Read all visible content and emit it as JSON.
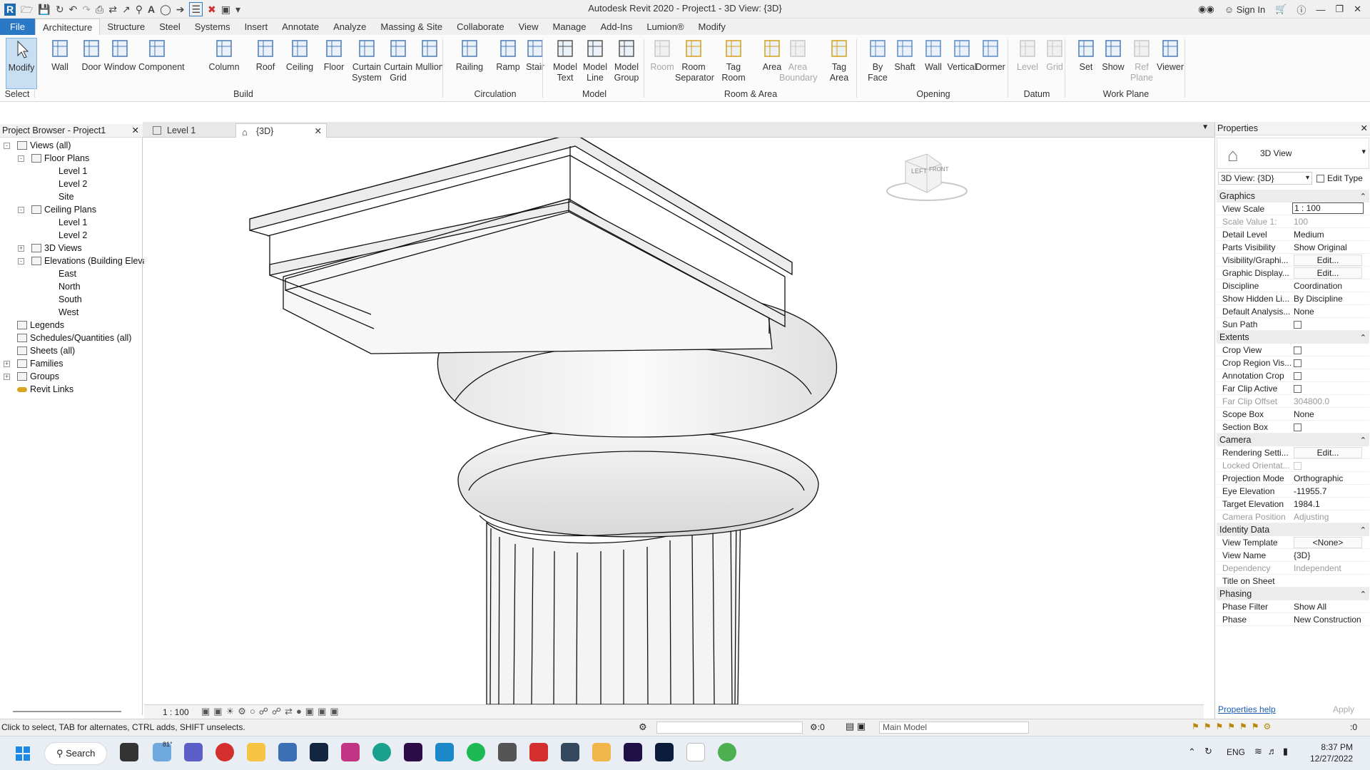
{
  "app": {
    "title": "Autodesk Revit 2020 - Project1 - 3D View: {3D}",
    "sign_in": "Sign In"
  },
  "ribbon_tabs": [
    "File",
    "Architecture",
    "Structure",
    "Steel",
    "Systems",
    "Insert",
    "Annotate",
    "Analyze",
    "Massing & Site",
    "Collaborate",
    "View",
    "Manage",
    "Add-Ins",
    "Lumion®",
    "Modify"
  ],
  "ribbon": {
    "select": {
      "modify": "Modify",
      "panel": "Select"
    },
    "build": {
      "items": [
        "Wall",
        "Door",
        "Window",
        "Component",
        "Column",
        "Roof",
        "Ceiling",
        "Floor",
        "Curtain\nSystem",
        "Curtain\nGrid",
        "Mullion"
      ],
      "panel": "Build"
    },
    "circulation": {
      "items": [
        "Railing",
        "Ramp",
        "Stair"
      ],
      "panel": "Circulation"
    },
    "model": {
      "items": [
        "Model\nText",
        "Model\nLine",
        "Model\nGroup"
      ],
      "panel": "Model"
    },
    "room_area": {
      "items": [
        "Room",
        "Room\nSeparator",
        "Tag\nRoom",
        "Area",
        "Area\nBoundary",
        "Tag\nArea"
      ],
      "panel": "Room & Area"
    },
    "opening": {
      "items": [
        "By\nFace",
        "Shaft",
        "Wall",
        "Vertical",
        "Dormer"
      ],
      "panel": "Opening"
    },
    "datum": {
      "items": [
        "Level",
        "Grid"
      ],
      "panel": "Datum"
    },
    "work_plane": {
      "items": [
        "Set",
        "Show",
        "Ref\nPlane",
        "Viewer"
      ],
      "panel": "Work Plane"
    }
  },
  "browser": {
    "title": "Project Browser - Project1",
    "items": [
      {
        "label": "Views (all)",
        "level": 0,
        "box": "-"
      },
      {
        "label": "Floor Plans",
        "level": 1,
        "box": "-"
      },
      {
        "label": "Level 1",
        "level": 2
      },
      {
        "label": "Level 2",
        "level": 2
      },
      {
        "label": "Site",
        "level": 2
      },
      {
        "label": "Ceiling Plans",
        "level": 1,
        "box": "-"
      },
      {
        "label": "Level 1",
        "level": 2
      },
      {
        "label": "Level 2",
        "level": 2
      },
      {
        "label": "3D Views",
        "level": 1,
        "box": "+"
      },
      {
        "label": "Elevations (Building Elevation)",
        "level": 1,
        "box": "-"
      },
      {
        "label": "East",
        "level": 2
      },
      {
        "label": "North",
        "level": 2
      },
      {
        "label": "South",
        "level": 2
      },
      {
        "label": "West",
        "level": 2
      },
      {
        "label": "Legends",
        "level": 0
      },
      {
        "label": "Schedules/Quantities (all)",
        "level": 0
      },
      {
        "label": "Sheets (all)",
        "level": 0
      },
      {
        "label": "Families",
        "level": 0,
        "box": "+"
      },
      {
        "label": "Groups",
        "level": 0,
        "box": "+"
      },
      {
        "label": "Revit Links",
        "level": 0
      }
    ]
  },
  "view_tabs": [
    "Level 1",
    "{3D}"
  ],
  "viewcube": {
    "left": "LEFT",
    "front": "FRONT"
  },
  "view_control": {
    "scale": "1 : 100"
  },
  "properties": {
    "title": "Properties",
    "type_name": "3D View",
    "selector": "3D View: {3D}",
    "edit_type": "Edit Type",
    "groups": [
      {
        "name": "Graphics",
        "rows": [
          {
            "k": "View Scale",
            "v": "1 : 100",
            "box": true
          },
          {
            "k": "Scale Value    1:",
            "v": "100",
            "dim": true
          },
          {
            "k": "Detail Level",
            "v": "Medium"
          },
          {
            "k": "Parts Visibility",
            "v": "Show Original"
          },
          {
            "k": "Visibility/Graphi...",
            "v": "Edit...",
            "btn": true
          },
          {
            "k": "Graphic Display...",
            "v": "Edit...",
            "btn": true
          },
          {
            "k": "Discipline",
            "v": "Coordination"
          },
          {
            "k": "Show Hidden Li...",
            "v": "By Discipline"
          },
          {
            "k": "Default Analysis...",
            "v": "None"
          },
          {
            "k": "Sun Path",
            "chk": true
          }
        ]
      },
      {
        "name": "Extents",
        "rows": [
          {
            "k": "Crop View",
            "chk": true
          },
          {
            "k": "Crop Region Vis...",
            "chk": true
          },
          {
            "k": "Annotation Crop",
            "chk": true
          },
          {
            "k": "Far Clip Active",
            "chk": true
          },
          {
            "k": "Far Clip Offset",
            "v": "304800.0",
            "dim": true
          },
          {
            "k": "Scope Box",
            "v": "None"
          },
          {
            "k": "Section Box",
            "chk": true
          }
        ]
      },
      {
        "name": "Camera",
        "rows": [
          {
            "k": "Rendering Setti...",
            "v": "Edit...",
            "btn": true
          },
          {
            "k": "Locked Orientat...",
            "chk": true,
            "dim": true
          },
          {
            "k": "Projection Mode",
            "v": "Orthographic"
          },
          {
            "k": "Eye Elevation",
            "v": "-11955.7"
          },
          {
            "k": "Target Elevation",
            "v": "1984.1"
          },
          {
            "k": "Camera Position",
            "v": "Adjusting",
            "dim": true
          }
        ]
      },
      {
        "name": "Identity Data",
        "rows": [
          {
            "k": "View Template",
            "v": "<None>",
            "btn": true
          },
          {
            "k": "View Name",
            "v": "{3D}"
          },
          {
            "k": "Dependency",
            "v": "Independent",
            "dim": true
          },
          {
            "k": "Title on Sheet",
            "v": ""
          }
        ]
      },
      {
        "name": "Phasing",
        "rows": [
          {
            "k": "Phase Filter",
            "v": "Show All"
          },
          {
            "k": "Phase",
            "v": "New Construction"
          }
        ]
      }
    ],
    "help": "Properties help",
    "apply": "Apply"
  },
  "status": {
    "hint": "Click to select, TAB for alternates, CTRL adds, SHIFT unselects.",
    "zero": ":0",
    "model": "Main Model",
    "filter_count": ":0"
  },
  "taskbar": {
    "search": "Search",
    "temp": "81°",
    "lang": "ENG",
    "time": "8:37 PM",
    "date": "12/27/2022"
  },
  "colors": {
    "accent": "#2a79c6",
    "ribbon_bg": "#fbfbfb",
    "selected": "#c8def3"
  }
}
